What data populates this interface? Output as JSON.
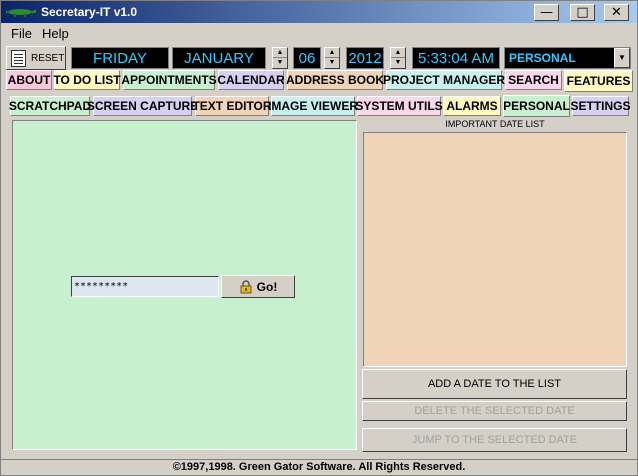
{
  "window": {
    "title": "Secretary-IT v1.0",
    "minimize": "—",
    "maximize": "□",
    "close": "✕"
  },
  "menu": {
    "file": "File",
    "help": "Help"
  },
  "toolbar": {
    "reset_label": "RESET",
    "day": "FRIDAY",
    "month": "JANUARY",
    "date": "06",
    "year": "2012",
    "time": "5:33:04 AM",
    "category": "PERSONAL"
  },
  "main_tabs": [
    {
      "label": "ABOUT",
      "color": "#f8c8dc"
    },
    {
      "label": "TO DO LIST",
      "color": "#fff8c0"
    },
    {
      "label": "APPOINTMENTS",
      "color": "#c8f0d0"
    },
    {
      "label": "CALENDAR",
      "color": "#d8d0f0"
    },
    {
      "label": "ADDRESS BOOK",
      "color": "#f0d4b8"
    },
    {
      "label": "PROJECT MANAGER",
      "color": "#c8f0f0"
    },
    {
      "label": "SEARCH",
      "color": "#f8d8e8"
    },
    {
      "label": "FEATURES",
      "color": "#fff8c0"
    }
  ],
  "sub_tabs": [
    {
      "label": "SCRATCHPAD",
      "color": "#c8f0d0"
    },
    {
      "label": "SCREEN CAPTURE",
      "color": "#d8d0f0"
    },
    {
      "label": "TEXT EDITOR",
      "color": "#f0d4b8"
    },
    {
      "label": "IMAGE VIEWER",
      "color": "#c8f0f0"
    },
    {
      "label": "SYSTEM UTILS",
      "color": "#f8d8e8"
    },
    {
      "label": "ALARMS",
      "color": "#fff8c0"
    },
    {
      "label": "PERSONAL",
      "color": "#c8f0d0"
    },
    {
      "label": "SETTINGS",
      "color": "#d8d0f0"
    }
  ],
  "personal": {
    "password_value": "*********",
    "go_label": "Go!"
  },
  "date_list": {
    "label": "IMPORTANT DATE LIST",
    "add_button": "ADD A DATE TO THE LIST",
    "delete_button": "DELETE THE SELECTED DATE",
    "jump_button": "JUMP TO THE SELECTED DATE"
  },
  "status": "©1997,1998.  Green Gator Software.  All Rights Reserved."
}
